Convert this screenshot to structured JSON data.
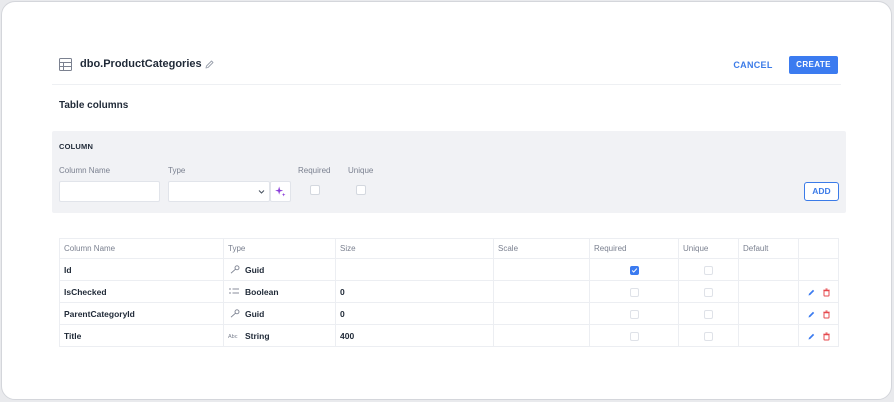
{
  "header": {
    "table_icon": "table-grid-icon",
    "title": "dbo.ProductCategories",
    "edit_icon": "pencil-icon",
    "cancel_label": "CANCEL",
    "create_label": "CREATE"
  },
  "section_title": "Table columns",
  "column_form": {
    "title": "COLUMN",
    "name_label": "Column Name",
    "name_value": "",
    "type_label": "Type",
    "type_value": "",
    "required_label": "Required",
    "required_checked": false,
    "unique_label": "Unique",
    "unique_checked": false,
    "add_label": "ADD"
  },
  "grid": {
    "headers": [
      "Column Name",
      "Type",
      "Size",
      "Scale",
      "Required",
      "Unique",
      "Default",
      ""
    ],
    "rows": [
      {
        "name": "Id",
        "type": "Guid",
        "type_icon": "key-icon",
        "size": "",
        "scale": "",
        "required": true,
        "unique": false,
        "default": "",
        "actions": false
      },
      {
        "name": "IsChecked",
        "type": "Boolean",
        "type_icon": "toggle-list-icon",
        "size": "0",
        "scale": "",
        "required": false,
        "unique": false,
        "default": "",
        "actions": true
      },
      {
        "name": "ParentCategoryId",
        "type": "Guid",
        "type_icon": "key-icon",
        "size": "0",
        "scale": "",
        "required": false,
        "unique": false,
        "default": "",
        "actions": true
      },
      {
        "name": "Title",
        "type": "String",
        "type_icon": "abc-icon",
        "size": "400",
        "scale": "",
        "required": false,
        "unique": false,
        "default": "",
        "actions": true
      }
    ]
  },
  "colors": {
    "accent": "#3b7bf0",
    "delete": "#e5484d",
    "panel_bg": "#f1f2f5"
  }
}
